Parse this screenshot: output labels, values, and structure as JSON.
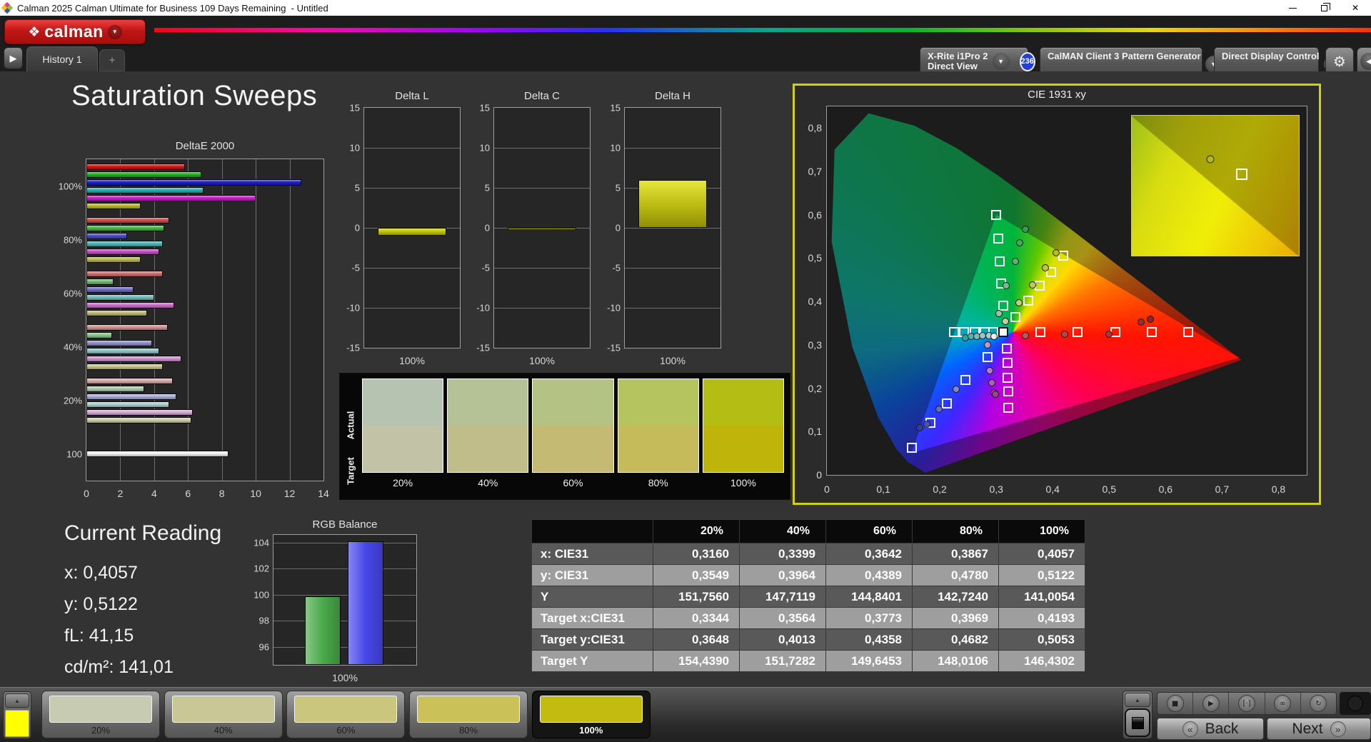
{
  "window": {
    "title": "Calman 2025 Calman Ultimate for Business 109 Days Remaining  - Untitled"
  },
  "icons": {
    "chevron_down": "▼",
    "chevron_up": "▲",
    "chevron_left": "◀",
    "play": "▶",
    "plus": "+",
    "gear": "⚙",
    "close": "✕",
    "diamond": "❖",
    "back_chevron": "«",
    "next_chevron": "»"
  },
  "header": {
    "logo_text": "calman",
    "tabs": {
      "history": "History 1",
      "add": "+"
    },
    "toolbar": {
      "meter": {
        "line1": "X-Rite i1Pro 2",
        "line2": "Direct View",
        "badge": "236",
        "status_color": "#35d435"
      },
      "pattern_generator": {
        "label": "CalMAN Client 3 Pattern Generator",
        "status_color": "#35d435"
      },
      "display_control": {
        "label": "Direct Display Control",
        "status_color": "#e0e010"
      }
    }
  },
  "page": {
    "title": "Saturation Sweeps"
  },
  "current_reading": {
    "title": "Current Reading",
    "lines": [
      "x: 0,4057",
      "y: 0,5122",
      "fL: 41,15",
      "cd/m²: 141,01"
    ]
  },
  "swatch_panel": {
    "row_labels": [
      "Actual",
      "Target"
    ],
    "columns": [
      {
        "label": "20%",
        "actual": "#b6c3b0",
        "target": "#c2c2a6"
      },
      {
        "label": "40%",
        "actual": "#b5c295",
        "target": "#c1bd8a"
      },
      {
        "label": "60%",
        "actual": "#b4c383",
        "target": "#c4ba74"
      },
      {
        "label": "80%",
        "actual": "#b5c45e",
        "target": "#c5bb5a"
      },
      {
        "label": "100%",
        "actual": "#b3bd14",
        "target": "#bfb40a"
      }
    ]
  },
  "bottom_bar": {
    "reference_swatch_color": "#ffff00",
    "patterns": [
      {
        "label": "20%",
        "color": "#c7cbb2",
        "selected": false
      },
      {
        "label": "40%",
        "color": "#c9c795",
        "selected": false
      },
      {
        "label": "60%",
        "color": "#cac67d",
        "selected": false
      },
      {
        "label": "80%",
        "color": "#cac159",
        "selected": false
      },
      {
        "label": "100%",
        "color": "#c3bb10",
        "selected": true
      }
    ],
    "media_buttons": [
      {
        "name": "stop-button",
        "glyph": "■"
      },
      {
        "name": "play-button",
        "glyph": "▶"
      },
      {
        "name": "measure-button",
        "glyph": "[·]"
      },
      {
        "name": "continuous-button",
        "glyph": "∞"
      },
      {
        "name": "loop-button",
        "glyph": "↻"
      }
    ],
    "back_label": "Back",
    "next_label": "Next"
  },
  "chart_data": [
    {
      "type": "bar",
      "orientation": "horizontal",
      "title": "DeltaE 2000",
      "series_names": [
        "Red",
        "Green",
        "Blue",
        "Cyan",
        "Magenta",
        "Yellow"
      ],
      "xlim": [
        0,
        14
      ],
      "xticks": [
        "0",
        "2",
        "4",
        "6",
        "8",
        "10",
        "12",
        "14"
      ],
      "groups": [
        {
          "label": "100%",
          "values": [
            5.8,
            6.8,
            12.7,
            6.9,
            10.0,
            3.2
          ],
          "colors": [
            "#cf1616",
            "#1cb41c",
            "#1e1ec2",
            "#1cb4b4",
            "#c81ec8",
            "#b8b81e"
          ]
        },
        {
          "label": "80%",
          "values": [
            4.9,
            4.6,
            2.4,
            4.5,
            4.3,
            3.2
          ],
          "colors": [
            "#cf4a4a",
            "#4ab44a",
            "#4a4ac2",
            "#4ab4b4",
            "#c84ac8",
            "#b8b84e"
          ]
        },
        {
          "label": "60%",
          "values": [
            4.5,
            1.6,
            2.8,
            4.0,
            5.2,
            3.6
          ],
          "colors": [
            "#cf6e6e",
            "#6ebc6e",
            "#6e6ec6",
            "#6ebcbc",
            "#cc6ecc",
            "#bcbc74"
          ]
        },
        {
          "label": "40%",
          "values": [
            4.8,
            1.5,
            3.9,
            4.3,
            5.6,
            4.5
          ],
          "colors": [
            "#d28f8f",
            "#8fc28f",
            "#8f8fd2",
            "#8fc6c6",
            "#d28fd2",
            "#c6c490"
          ]
        },
        {
          "label": "20%",
          "values": [
            5.1,
            3.4,
            5.3,
            4.9,
            6.3,
            6.2
          ],
          "colors": [
            "#d6abab",
            "#abccab",
            "#ababd6",
            "#abcfcf",
            "#d6abd6",
            "#cfcda6"
          ]
        },
        {
          "label": "100",
          "values": [
            8.4
          ],
          "colors": [
            "#f2f2f2"
          ]
        }
      ]
    },
    {
      "type": "bar",
      "title": "Delta L",
      "categories": [
        "100%"
      ],
      "values": [
        -1.0
      ],
      "ylim": [
        -15,
        15
      ],
      "yticks": [
        "15",
        "10",
        "5",
        "0",
        "-5",
        "-10",
        "-15"
      ]
    },
    {
      "type": "bar",
      "title": "Delta C",
      "categories": [
        "100%"
      ],
      "values": [
        -0.3
      ],
      "ylim": [
        -15,
        15
      ],
      "yticks": [
        "15",
        "10",
        "5",
        "0",
        "-5",
        "-10",
        "-15"
      ]
    },
    {
      "type": "bar",
      "title": "Delta H",
      "categories": [
        "100%"
      ],
      "values": [
        6.0
      ],
      "ylim": [
        -15,
        15
      ],
      "yticks": [
        "15",
        "10",
        "5",
        "0",
        "-5",
        "-10",
        "-15"
      ]
    },
    {
      "type": "scatter",
      "title": "CIE 1931 xy",
      "xlim": [
        0,
        0.85
      ],
      "ylim": [
        0,
        0.85
      ],
      "xticks": [
        "0",
        "0,1",
        "0,2",
        "0,3",
        "0,4",
        "0,5",
        "0,6",
        "0,7",
        "0,8"
      ],
      "yticks": [
        "0",
        "0,1",
        "0,2",
        "0,3",
        "0,4",
        "0,5",
        "0,6",
        "0,7",
        "0,8"
      ],
      "gamut_triangle": [
        [
          0.73,
          0.27
        ],
        [
          0.3,
          0.6
        ],
        [
          0.15,
          0.05
        ]
      ],
      "white_target": [
        0.3127,
        0.329
      ],
      "targets": {
        "red": [
          [
            0.378,
            0.33
          ],
          [
            0.444,
            0.33
          ],
          [
            0.511,
            0.33
          ],
          [
            0.576,
            0.33
          ],
          [
            0.64,
            0.33
          ]
        ],
        "green": [
          [
            0.312,
            0.39
          ],
          [
            0.309,
            0.442
          ],
          [
            0.306,
            0.492
          ],
          [
            0.303,
            0.546
          ],
          [
            0.3,
            0.6
          ]
        ],
        "blue": [
          [
            0.285,
            0.272
          ],
          [
            0.245,
            0.219
          ],
          [
            0.213,
            0.164
          ],
          [
            0.183,
            0.12
          ],
          [
            0.15,
            0.062
          ]
        ],
        "cyan": [
          [
            0.295,
            0.329
          ],
          [
            0.279,
            0.329
          ],
          [
            0.262,
            0.329
          ],
          [
            0.243,
            0.329
          ],
          [
            0.225,
            0.329
          ]
        ],
        "magenta": [
          [
            0.319,
            0.292
          ],
          [
            0.32,
            0.258
          ],
          [
            0.32,
            0.224
          ],
          [
            0.321,
            0.192
          ],
          [
            0.321,
            0.155
          ]
        ],
        "yellow": [
          [
            0.3344,
            0.3648
          ],
          [
            0.3564,
            0.4013
          ],
          [
            0.3773,
            0.4358
          ],
          [
            0.3969,
            0.4682
          ],
          [
            0.4193,
            0.5053
          ]
        ]
      },
      "measurements": {
        "red": [
          [
            0.352,
            0.321,
            "#b65a5a"
          ],
          [
            0.421,
            0.324,
            "#b44848"
          ],
          [
            0.499,
            0.325,
            "#ae3434"
          ],
          [
            0.557,
            0.353,
            "#9e2a2a"
          ],
          [
            0.573,
            0.359,
            "#8e2424"
          ]
        ],
        "green": [
          [
            0.352,
            0.566,
            "#2f9f55"
          ],
          [
            0.341,
            0.536,
            "#44a862"
          ],
          [
            0.334,
            0.492,
            "#5bb274"
          ],
          [
            0.318,
            0.437,
            "#79bc8d"
          ],
          [
            0.305,
            0.372,
            "#93c6a2"
          ]
        ],
        "blue": [
          [
            0.229,
            0.198,
            "#8289c4"
          ],
          [
            0.199,
            0.152,
            "#666eb6"
          ],
          [
            0.177,
            0.117,
            "#4b54aa"
          ],
          [
            0.165,
            0.109,
            "#343d9e"
          ]
        ],
        "cyan": [
          [
            0.245,
            0.317,
            "#2aa4a4"
          ],
          [
            0.256,
            0.319,
            "#58aeae"
          ],
          [
            0.266,
            0.32,
            "#7cbaba"
          ],
          [
            0.276,
            0.321,
            "#98c4c4"
          ],
          [
            0.287,
            0.322,
            "#accccc"
          ]
        ],
        "magenta": [
          [
            0.285,
            0.299,
            "#c492c4"
          ],
          [
            0.288,
            0.241,
            "#bc7abc"
          ],
          [
            0.292,
            0.212,
            "#b262ac"
          ],
          [
            0.296,
            0.19,
            "#a84a9a"
          ],
          [
            0.298,
            0.186,
            "#a04292"
          ]
        ],
        "yellow": [
          [
            0.316,
            0.3549,
            "#cccc9e"
          ],
          [
            0.3399,
            0.3964,
            "#c9c981"
          ],
          [
            0.3642,
            0.4389,
            "#c6c662"
          ],
          [
            0.3867,
            0.478,
            "#c2c243"
          ],
          [
            0.4057,
            0.5122,
            "#babb1c"
          ]
        ],
        "white": [
          [
            0.296,
            0.32,
            "#ececec"
          ]
        ]
      },
      "inset": {
        "circle": {
          "left_pct": 47,
          "top_pct": 31
        },
        "square": {
          "left_pct": 66,
          "top_pct": 42
        }
      }
    },
    {
      "type": "bar",
      "title": "RGB Balance",
      "categories": [
        "100%"
      ],
      "ylim": [
        94.6,
        104.6
      ],
      "yticks": [
        "104",
        "102",
        "100",
        "98",
        "96"
      ],
      "series": [
        {
          "name": "Green",
          "color": "#4aa94a",
          "values": [
            99.9
          ]
        },
        {
          "name": "Blue",
          "color": "#4747ea",
          "values": [
            104.1
          ]
        }
      ]
    },
    {
      "type": "table",
      "col_headers": [
        "",
        "20%",
        "40%",
        "60%",
        "80%",
        "100%"
      ],
      "rows": [
        {
          "label": "x: CIE31",
          "values": [
            "0,3160",
            "0,3399",
            "0,3642",
            "0,3867",
            "0,4057"
          ]
        },
        {
          "label": "y: CIE31",
          "values": [
            "0,3549",
            "0,3964",
            "0,4389",
            "0,4780",
            "0,5122"
          ]
        },
        {
          "label": "Y",
          "values": [
            "151,7560",
            "147,7119",
            "144,8401",
            "142,7240",
            "141,0054"
          ]
        },
        {
          "label": "Target x:CIE31",
          "values": [
            "0,3344",
            "0,3564",
            "0,3773",
            "0,3969",
            "0,4193"
          ]
        },
        {
          "label": "Target y:CIE31",
          "values": [
            "0,3648",
            "0,4013",
            "0,4358",
            "0,4682",
            "0,5053"
          ]
        },
        {
          "label": "Target Y",
          "values": [
            "154,4390",
            "151,7282",
            "149,6453",
            "148,0106",
            "146,4302"
          ]
        }
      ]
    }
  ]
}
